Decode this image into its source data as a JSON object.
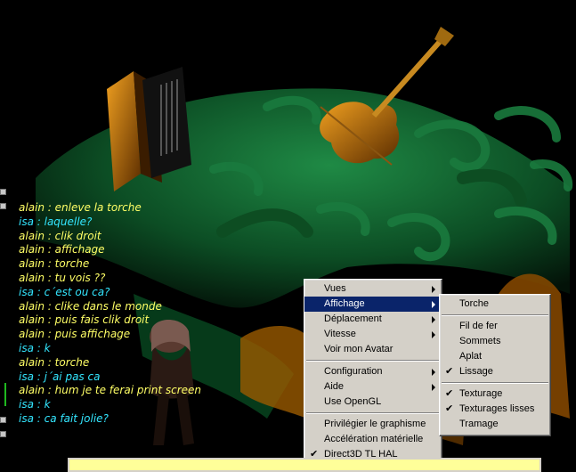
{
  "chat": [
    {
      "text": "alain : enleve la torche",
      "color": "#ffff66"
    },
    {
      "text": "isa : laquelle?",
      "color": "#33e6ff"
    },
    {
      "text": "alain : clik droit",
      "color": "#ffff66"
    },
    {
      "text": "alain : affichage",
      "color": "#ffff66"
    },
    {
      "text": "alain : torche",
      "color": "#ffff66"
    },
    {
      "text": "alain : tu vois ??",
      "color": "#ffff66"
    },
    {
      "text": "isa : c´est ou ca?",
      "color": "#33e6ff"
    },
    {
      "text": "alain : clike dans le monde",
      "color": "#ffff66"
    },
    {
      "text": "alain : puis fais clik droit",
      "color": "#ffff66"
    },
    {
      "text": "alain : puis affichage",
      "color": "#ffff66"
    },
    {
      "text": "isa : k",
      "color": "#33e6ff"
    },
    {
      "text": "alain : torche",
      "color": "#ffff66"
    },
    {
      "text": "isa : j´ai pas ca",
      "color": "#33e6ff"
    },
    {
      "text": "alain : hum je te ferai print screen",
      "color": "#ffff66"
    },
    {
      "text": "isa : k",
      "color": "#33e6ff"
    },
    {
      "text": "isa : ca fait jolie?",
      "color": "#33e6ff"
    }
  ],
  "context_menu": {
    "items": [
      {
        "label": "Vues",
        "submenu": true
      },
      {
        "label": "Affichage",
        "submenu": true,
        "highlighted": true
      },
      {
        "label": "Déplacement",
        "submenu": true
      },
      {
        "label": "Vitesse",
        "submenu": true
      },
      {
        "label": "Voir mon Avatar"
      },
      {
        "sep": true
      },
      {
        "label": "Configuration",
        "submenu": true
      },
      {
        "label": "Aide",
        "submenu": true
      },
      {
        "label": "Use OpenGL"
      },
      {
        "sep": true
      },
      {
        "label": "Privilégier le graphisme"
      },
      {
        "label": "Accélération matérielle"
      },
      {
        "label": "Direct3D TL HAL",
        "checked": true
      }
    ]
  },
  "affichage_submenu": {
    "items": [
      {
        "label": "Torche"
      },
      {
        "sep": true
      },
      {
        "label": "Fil de fer"
      },
      {
        "label": "Sommets"
      },
      {
        "label": "Aplat"
      },
      {
        "label": "Lissage",
        "checked": true
      },
      {
        "sep": true
      },
      {
        "label": "Texturage",
        "checked": true
      },
      {
        "label": "Texturages lisses",
        "checked": true
      },
      {
        "label": "Tramage"
      }
    ]
  },
  "check_mark": "✔",
  "colors": {
    "menu_bg": "#d4d0c8",
    "menu_highlight": "#0a246a",
    "input_bg": "#ffff99",
    "scene_green": "#0e5a2a",
    "scene_orange": "#c87a10"
  }
}
